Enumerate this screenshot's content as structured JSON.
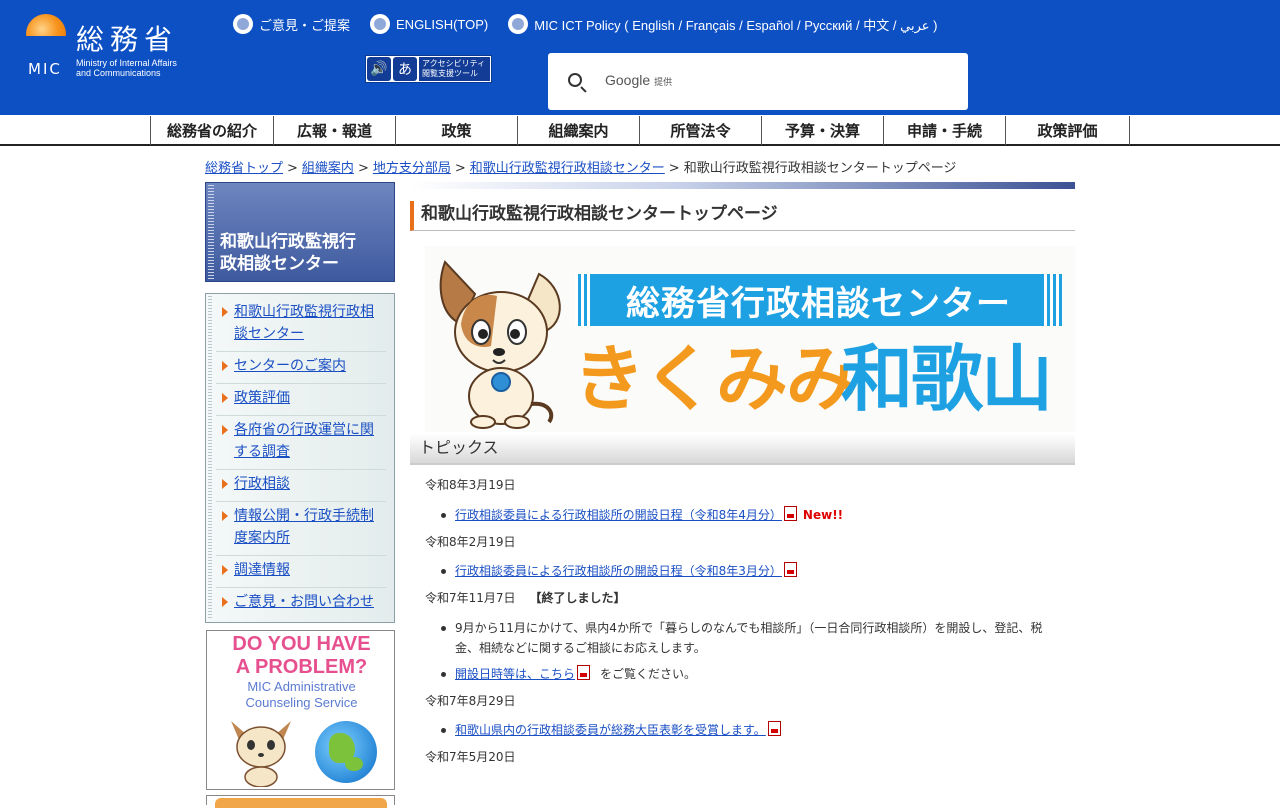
{
  "header": {
    "logo_jp": "総務省",
    "logo_mic": "MIC",
    "logo_en_1": "Ministry of Internal Affairs",
    "logo_en_2": "and Communications",
    "links": [
      {
        "label": "ご意見・ご提案"
      },
      {
        "label": "ENGLISH(TOP)"
      },
      {
        "label": "MIC ICT Policy ( English / Français / Español / Русский / 中文 / عربي )"
      }
    ],
    "a11y_tool": {
      "b1": "🔊",
      "b2": "あ",
      "text": "アクセシビリティ 閲覧支援ツール"
    },
    "search": {
      "brand": "Google",
      "brand_suffix": "提供"
    }
  },
  "gnav": [
    {
      "label": "総務省の紹介"
    },
    {
      "label": "広報・報道"
    },
    {
      "label": "政策"
    },
    {
      "label": "組織案内"
    },
    {
      "label": "所管法令"
    },
    {
      "label": "予算・決算"
    },
    {
      "label": "申請・手続"
    },
    {
      "label": "政策評価"
    }
  ],
  "breadcrumb": [
    {
      "label": "総務省トップ"
    },
    {
      "label": "組織案内"
    },
    {
      "label": "地方支分部局"
    },
    {
      "label": "和歌山行政監視行政相談センター"
    },
    {
      "label": "和歌山行政監視行政相談センタートップページ"
    }
  ],
  "sidebar": {
    "title_1": "和歌山行政監視行",
    "title_2": "政相談センター",
    "items": [
      {
        "label": "和歌山行政監視行政相談センター"
      },
      {
        "label": "センターのご案内"
      },
      {
        "label": "政策評価"
      },
      {
        "label": "各府省の行政運営に関する調査"
      },
      {
        "label": "行政相談"
      },
      {
        "label": "情報公開・行政手続制度案内所"
      },
      {
        "label": "調達情報"
      },
      {
        "label": "ご意見・お問い合わせ"
      }
    ],
    "banner": {
      "title_1": "DO YOU HAVE",
      "title_2": "A PROBLEM?",
      "sub_1": "MIC Administrative",
      "sub_2": "Counseling Service"
    }
  },
  "main": {
    "page_title": "和歌山行政監視行政相談センタートップページ",
    "hero": {
      "band": "総務省行政相談センター",
      "sub_orange": "きくみみ",
      "sub_blue": "和歌山"
    },
    "topics_heading": "トピックス",
    "topics": [
      {
        "date": "令和8年3月19日",
        "status": "",
        "items": [
          {
            "link": "行政相談委員による行政相談所の開設日程（令和8年4月分）",
            "after": "",
            "new": "New!!"
          }
        ]
      },
      {
        "date": "令和8年2月19日",
        "status": "",
        "items": [
          {
            "link": "行政相談委員による行政相談所の開設日程（令和8年3月分）",
            "after": "",
            "new": ""
          }
        ]
      },
      {
        "date": "令和7年11月7日",
        "status": "【終了しました】",
        "items": [
          {
            "text": "9月から11月にかけて、県内4か所で「暮らしのなんでも相談所」（一日合同行政相談所）を開設し、登記、税金、相続などに関するご相談にお応えします。"
          },
          {
            "link": "開設日時等は、こちら",
            "after": "をご覧ください。",
            "new": ""
          }
        ]
      },
      {
        "date": "令和7年8月29日",
        "status": "",
        "items": [
          {
            "link": "和歌山県内の行政相談委員が総務大臣表彰を受賞します。",
            "after": "",
            "new": ""
          }
        ]
      },
      {
        "date": "令和7年5月20日",
        "status": "",
        "items": []
      }
    ]
  }
}
